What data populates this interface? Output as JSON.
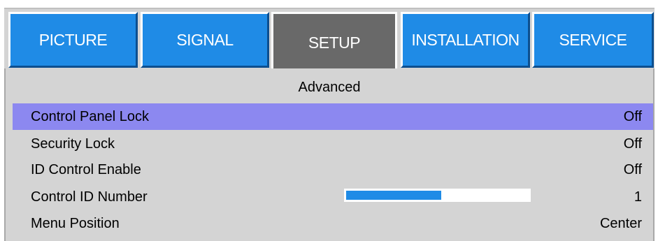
{
  "tabs": [
    {
      "label": "PICTURE",
      "active": false
    },
    {
      "label": "SIGNAL",
      "active": false
    },
    {
      "label": "SETUP",
      "active": true
    },
    {
      "label": "INSTALLATION",
      "active": false
    },
    {
      "label": "SERVICE",
      "active": false
    }
  ],
  "panel": {
    "title": "Advanced",
    "rows": [
      {
        "label": "Control Panel Lock",
        "value": "Off",
        "selected": true
      },
      {
        "label": "Security Lock",
        "value": "Off",
        "selected": false
      },
      {
        "label": "ID Control Enable",
        "value": "Off",
        "selected": false
      },
      {
        "label": "Control ID Number",
        "value": "1",
        "selected": false,
        "slider_fraction": 0.52
      },
      {
        "label": "Menu Position",
        "value": "Center",
        "selected": false
      }
    ]
  },
  "colors": {
    "tab_blue": "#1f8be6",
    "tab_active": "#696969",
    "selection": "#8c88f0",
    "panel_bg": "#d4d4d4"
  }
}
